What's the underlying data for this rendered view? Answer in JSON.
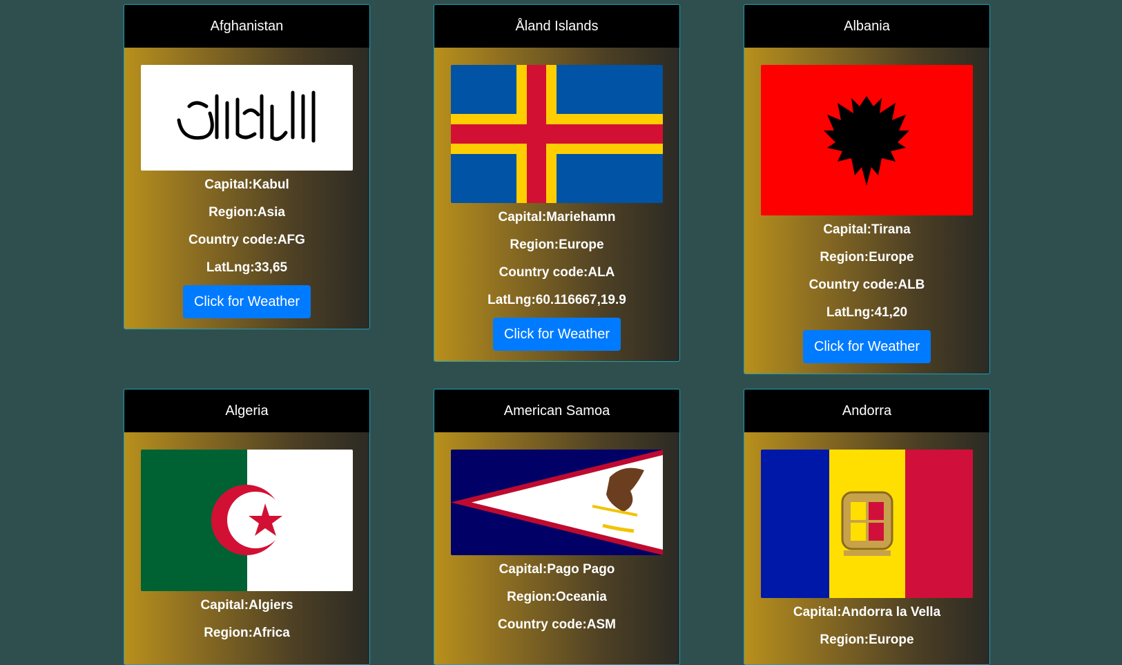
{
  "cards": [
    {
      "name": "Afghanistan",
      "capital": "Capital:Kabul",
      "region": "Region:Asia",
      "code": "Country code:AFG",
      "latlng": "LatLng:33,65",
      "button": "Click for Weather",
      "flag_icon": "afghanistan-flag"
    },
    {
      "name": "Åland Islands",
      "capital": "Capital:Mariehamn",
      "region": "Region:Europe",
      "code": "Country code:ALA",
      "latlng": "LatLng:60.116667,19.9",
      "button": "Click for Weather",
      "flag_icon": "aland-flag"
    },
    {
      "name": "Albania",
      "capital": "Capital:Tirana",
      "region": "Region:Europe",
      "code": "Country code:ALB",
      "latlng": "LatLng:41,20",
      "button": "Click for Weather",
      "flag_icon": "albania-flag"
    },
    {
      "name": "Algeria",
      "capital": "Capital:Algiers",
      "region": "Region:Africa",
      "flag_icon": "algeria-flag"
    },
    {
      "name": "American Samoa",
      "capital": "Capital:Pago Pago",
      "region": "Region:Oceania",
      "code": "Country code:ASM",
      "flag_icon": "american-samoa-flag"
    },
    {
      "name": "Andorra",
      "capital": "Capital:Andorra la Vella",
      "region": "Region:Europe",
      "flag_icon": "andorra-flag"
    }
  ],
  "colors": {
    "background": "#2f4f4f",
    "button": "#007bff",
    "card_border": "#17a2b8"
  }
}
